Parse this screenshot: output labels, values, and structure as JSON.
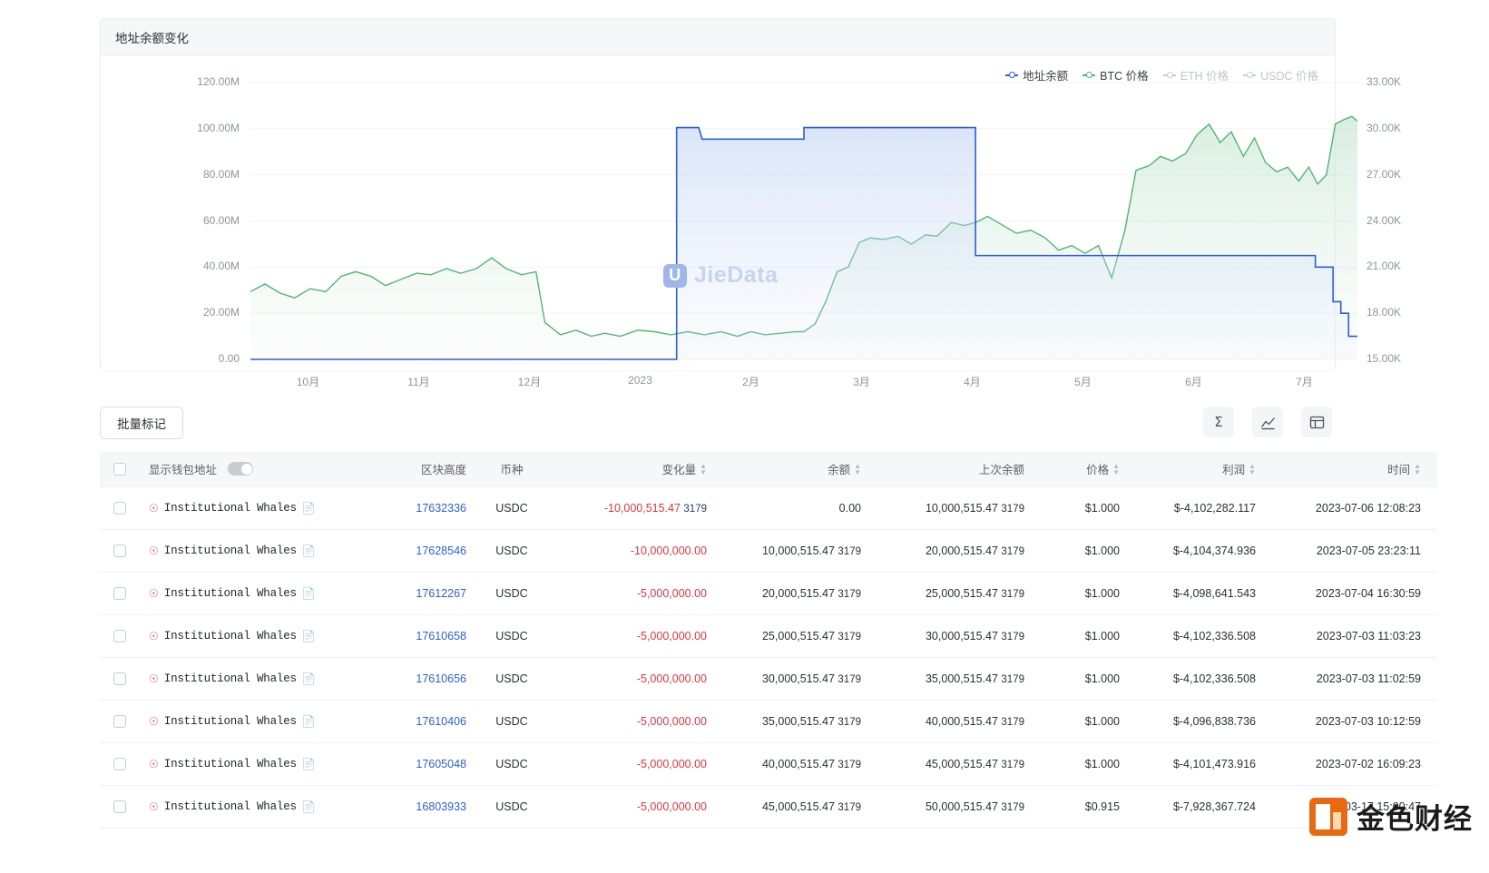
{
  "chart": {
    "title": "地址余额变化",
    "legend": [
      {
        "label": "地址余额",
        "color": "#2b5fd9",
        "active": true
      },
      {
        "label": "BTC 价格",
        "color": "#52b572",
        "active": true
      },
      {
        "label": "ETH 价格",
        "color": "#c6cbd2",
        "active": false
      },
      {
        "label": "USDC 价格",
        "color": "#c6cbd2",
        "active": false
      }
    ],
    "watermark": "JieData"
  },
  "chart_data": {
    "type": "line",
    "title": "地址余额变化",
    "xlabel": "",
    "ylabel": "",
    "grid": true,
    "legend_position": "top-right",
    "x_ticks": [
      "10月",
      "11月",
      "12月",
      "2023",
      "2月",
      "3月",
      "4月",
      "5月",
      "6月",
      "7月"
    ],
    "y_left": {
      "ticks": [
        "0.00",
        "20.00M",
        "40.00M",
        "60.00M",
        "80.00M",
        "100.00M",
        "120.00M"
      ],
      "min": 0,
      "max": 120000000,
      "label": "地址余额"
    },
    "y_right": {
      "ticks": [
        "15.00K",
        "18.00K",
        "21.00K",
        "24.00K",
        "27.00K",
        "30.00K",
        "33.00K"
      ],
      "min": 15000,
      "max": 33000,
      "label": "BTC 价格"
    },
    "series": [
      {
        "name": "地址余额",
        "color": "#2b5fd9",
        "axis": "left",
        "type": "step-area",
        "points": [
          [
            0.0,
            0
          ],
          [
            0.385,
            0
          ],
          [
            0.385,
            100500000
          ],
          [
            0.405,
            100500000
          ],
          [
            0.408,
            95500000
          ],
          [
            0.5,
            95500000
          ],
          [
            0.5,
            100500000
          ],
          [
            0.655,
            100500000
          ],
          [
            0.655,
            45000000
          ],
          [
            0.962,
            45000000
          ],
          [
            0.962,
            40000000
          ],
          [
            0.978,
            40000000
          ],
          [
            0.978,
            25000000
          ],
          [
            0.985,
            25000000
          ],
          [
            0.985,
            20000000
          ],
          [
            0.992,
            20000000
          ],
          [
            0.992,
            10000000
          ],
          [
            1.0,
            10000000
          ]
        ]
      },
      {
        "name": "BTC 价格",
        "color": "#52b572",
        "axis": "right",
        "type": "area",
        "points": [
          [
            0.0,
            19400
          ],
          [
            0.013,
            19900
          ],
          [
            0.027,
            19300
          ],
          [
            0.04,
            19000
          ],
          [
            0.054,
            19600
          ],
          [
            0.068,
            19400
          ],
          [
            0.082,
            20400
          ],
          [
            0.095,
            20700
          ],
          [
            0.109,
            20400
          ],
          [
            0.122,
            19800
          ],
          [
            0.136,
            20200
          ],
          [
            0.15,
            20600
          ],
          [
            0.163,
            20500
          ],
          [
            0.177,
            20900
          ],
          [
            0.19,
            20600
          ],
          [
            0.204,
            20900
          ],
          [
            0.218,
            21600
          ],
          [
            0.231,
            20900
          ],
          [
            0.245,
            20500
          ],
          [
            0.258,
            20700
          ],
          [
            0.266,
            17400
          ],
          [
            0.28,
            16600
          ],
          [
            0.294,
            16900
          ],
          [
            0.308,
            16500
          ],
          [
            0.32,
            16700
          ],
          [
            0.334,
            16500
          ],
          [
            0.35,
            16900
          ],
          [
            0.365,
            16800
          ],
          [
            0.38,
            16600
          ],
          [
            0.395,
            16800
          ],
          [
            0.41,
            16600
          ],
          [
            0.425,
            16800
          ],
          [
            0.44,
            16500
          ],
          [
            0.452,
            16800
          ],
          [
            0.465,
            16600
          ],
          [
            0.479,
            16700
          ],
          [
            0.492,
            16800
          ],
          [
            0.5,
            16800
          ],
          [
            0.51,
            17300
          ],
          [
            0.52,
            18800
          ],
          [
            0.53,
            20700
          ],
          [
            0.54,
            21000
          ],
          [
            0.55,
            22600
          ],
          [
            0.56,
            22900
          ],
          [
            0.572,
            22800
          ],
          [
            0.585,
            23000
          ],
          [
            0.597,
            22500
          ],
          [
            0.61,
            23100
          ],
          [
            0.62,
            23000
          ],
          [
            0.633,
            23900
          ],
          [
            0.645,
            23700
          ],
          [
            0.655,
            23900
          ],
          [
            0.666,
            24300
          ],
          [
            0.68,
            23700
          ],
          [
            0.692,
            23200
          ],
          [
            0.705,
            23400
          ],
          [
            0.718,
            22900
          ],
          [
            0.73,
            22100
          ],
          [
            0.742,
            22400
          ],
          [
            0.754,
            21900
          ],
          [
            0.766,
            22400
          ],
          [
            0.778,
            20300
          ],
          [
            0.79,
            23400
          ],
          [
            0.8,
            27300
          ],
          [
            0.812,
            27600
          ],
          [
            0.822,
            28200
          ],
          [
            0.833,
            27900
          ],
          [
            0.845,
            28400
          ],
          [
            0.855,
            29600
          ],
          [
            0.866,
            30300
          ],
          [
            0.876,
            29100
          ],
          [
            0.886,
            29800
          ],
          [
            0.897,
            28200
          ],
          [
            0.907,
            29400
          ],
          [
            0.917,
            27800
          ],
          [
            0.927,
            27200
          ],
          [
            0.937,
            27500
          ],
          [
            0.947,
            26600
          ],
          [
            0.956,
            27500
          ],
          [
            0.964,
            26400
          ],
          [
            0.972,
            27000
          ],
          [
            0.98,
            30300
          ],
          [
            0.988,
            30600
          ],
          [
            0.995,
            30800
          ],
          [
            1.0,
            30500
          ]
        ]
      }
    ]
  },
  "toolbar": {
    "batch_mark": "批量标记",
    "icons": [
      {
        "name": "sigma-icon",
        "glyph": "Σ"
      },
      {
        "name": "chart-icon",
        "glyph": "chart"
      },
      {
        "name": "table-icon",
        "glyph": "table"
      }
    ]
  },
  "table": {
    "columns": [
      {
        "key": "checkbox",
        "label": "",
        "sortable": false
      },
      {
        "key": "name",
        "label": "显示钱包地址",
        "sortable": false
      },
      {
        "key": "block",
        "label": "区块高度",
        "sortable": false
      },
      {
        "key": "coin",
        "label": "币种",
        "sortable": false
      },
      {
        "key": "change",
        "label": "变化量",
        "sortable": true
      },
      {
        "key": "balance",
        "label": "余额",
        "sortable": true
      },
      {
        "key": "prev_balance",
        "label": "上次余额",
        "sortable": false
      },
      {
        "key": "price",
        "label": "价格",
        "sortable": true
      },
      {
        "key": "profit",
        "label": "利润",
        "sortable": true
      },
      {
        "key": "time",
        "label": "时间",
        "sortable": true
      }
    ],
    "show_wallet_toggle": false,
    "rows": [
      {
        "name": "Institutional Whales",
        "block": "17632336",
        "coin": "USDC",
        "change": "-10,000,515.47",
        "change_sub": "3179",
        "balance": "0.00",
        "balance_sub": "",
        "prev": "10,000,515.47",
        "prev_sub": "3179",
        "price": "$1.000",
        "profit": "$-4,102,282.117",
        "time": "2023-07-06 12:08:23"
      },
      {
        "name": "Institutional Whales",
        "block": "17628546",
        "coin": "USDC",
        "change": "-10,000,000.00",
        "change_sub": "",
        "balance": "10,000,515.47",
        "balance_sub": "3179",
        "prev": "20,000,515.47",
        "prev_sub": "3179",
        "price": "$1.000",
        "profit": "$-4,104,374.936",
        "time": "2023-07-05 23:23:11"
      },
      {
        "name": "Institutional Whales",
        "block": "17612267",
        "coin": "USDC",
        "change": "-5,000,000.00",
        "change_sub": "",
        "balance": "20,000,515.47",
        "balance_sub": "3179",
        "prev": "25,000,515.47",
        "prev_sub": "3179",
        "price": "$1.000",
        "profit": "$-4,098,641.543",
        "time": "2023-07-04 16:30:59"
      },
      {
        "name": "Institutional Whales",
        "block": "17610658",
        "coin": "USDC",
        "change": "-5,000,000.00",
        "change_sub": "",
        "balance": "25,000,515.47",
        "balance_sub": "3179",
        "prev": "30,000,515.47",
        "prev_sub": "3179",
        "price": "$1.000",
        "profit": "$-4,102,336.508",
        "time": "2023-07-03 11:03:23"
      },
      {
        "name": "Institutional Whales",
        "block": "17610656",
        "coin": "USDC",
        "change": "-5,000,000.00",
        "change_sub": "",
        "balance": "30,000,515.47",
        "balance_sub": "3179",
        "prev": "35,000,515.47",
        "prev_sub": "3179",
        "price": "$1.000",
        "profit": "$-4,102,336.508",
        "time": "2023-07-03 11:02:59"
      },
      {
        "name": "Institutional Whales",
        "block": "17610406",
        "coin": "USDC",
        "change": "-5,000,000.00",
        "change_sub": "",
        "balance": "35,000,515.47",
        "balance_sub": "3179",
        "prev": "40,000,515.47",
        "prev_sub": "3179",
        "price": "$1.000",
        "profit": "$-4,096,838.736",
        "time": "2023-07-03 10:12:59"
      },
      {
        "name": "Institutional Whales",
        "block": "17605048",
        "coin": "USDC",
        "change": "-5,000,000.00",
        "change_sub": "",
        "balance": "40,000,515.47",
        "balance_sub": "3179",
        "prev": "45,000,515.47",
        "prev_sub": "3179",
        "price": "$1.000",
        "profit": "$-4,101,473.916",
        "time": "2023-07-02 16:09:23"
      },
      {
        "name": "Institutional Whales",
        "block": "16803933",
        "coin": "USDC",
        "change": "-5,000,000.00",
        "change_sub": "",
        "balance": "45,000,515.47",
        "balance_sub": "3179",
        "prev": "50,000,515.47",
        "prev_sub": "3179",
        "price": "$0.915",
        "profit": "$-7,928,367.724",
        "time": "2023-03-17 15:00:47"
      }
    ]
  },
  "brand": {
    "text": "金色财经"
  }
}
